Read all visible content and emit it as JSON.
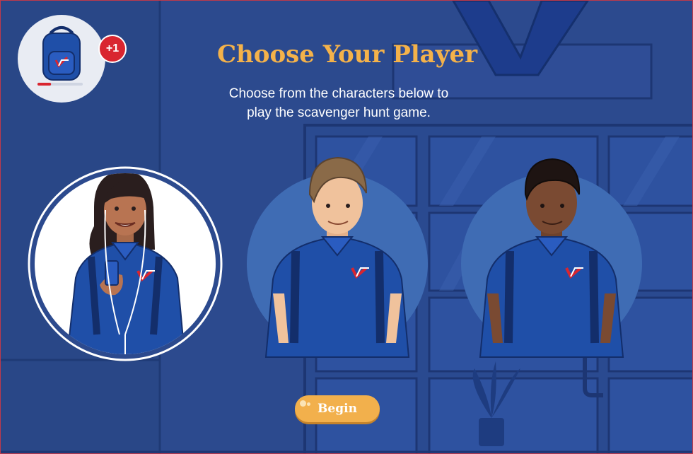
{
  "title": "Choose Your Player",
  "subtitle_line1": "Choose from the characters below to",
  "subtitle_line2": "play the scavenger hunt game.",
  "inventory": {
    "count_badge": "+1",
    "progress": 0.3,
    "icon": "backpack-icon"
  },
  "players": [
    {
      "id": "player-1",
      "selected": true
    },
    {
      "id": "player-2",
      "selected": false
    },
    {
      "id": "player-3",
      "selected": false
    }
  ],
  "begin_label": "Begin",
  "colors": {
    "background": "#2c4a8e",
    "accent": "#f4b24a",
    "shirt": "#1f4fa8",
    "badge_red": "#d9252f",
    "selection_circle": "#ffffff",
    "unselected_circle": "#3f6cb4"
  }
}
